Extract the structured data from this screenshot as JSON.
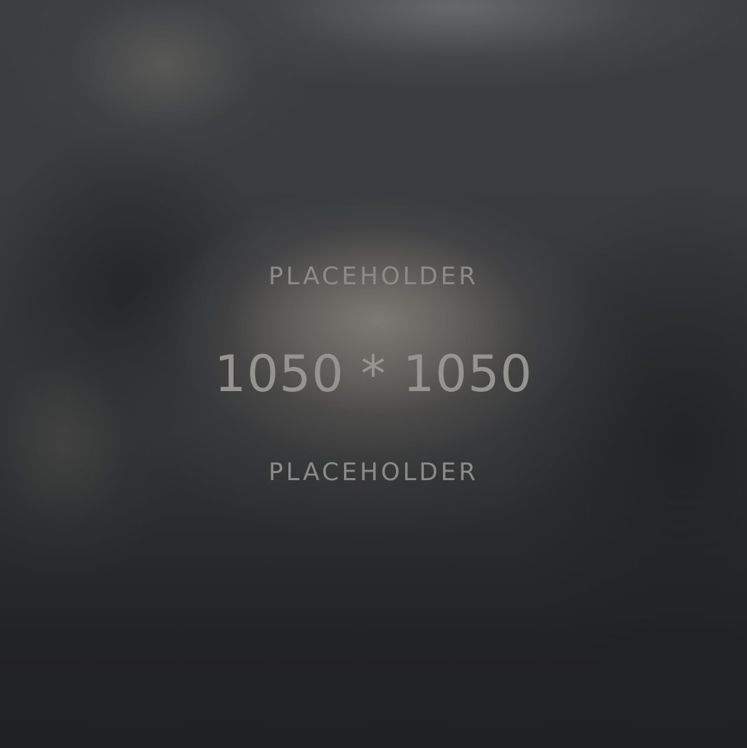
{
  "placeholder": {
    "top_text": "PLACEHOLDER",
    "dimensions_text": "1050 * 1050",
    "bottom_text": "PLACEHOLDER"
  },
  "colors": {
    "background_dark": "#222325",
    "background_center": "#807c76",
    "text": "#8c8b88"
  }
}
